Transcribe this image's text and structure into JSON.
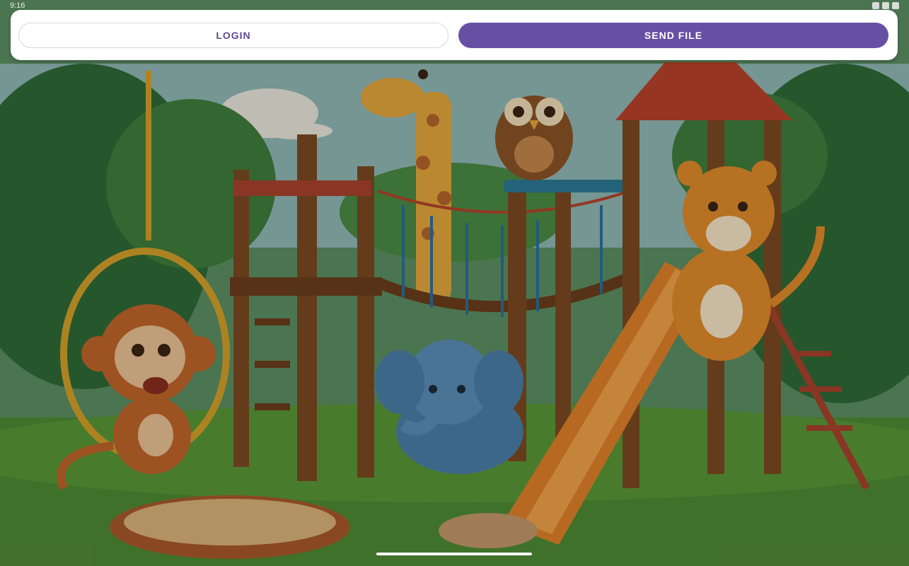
{
  "status_bar": {
    "time": "9:16"
  },
  "toolbar": {
    "login_label": "LOGIN",
    "send_file_label": "SEND FILE"
  },
  "colors": {
    "accent": "#6750a4",
    "login_text": "#5b4a9a",
    "sheet": "#ffffff"
  },
  "background": {
    "scene": "cartoon-jungle-playground",
    "icons": [
      "monkey-icon",
      "giraffe-icon",
      "owl-icon",
      "tiger-icon",
      "elephant-icon",
      "slide-icon",
      "sandbox-icon",
      "rope-bridge-icon",
      "tree-house-icon"
    ]
  }
}
